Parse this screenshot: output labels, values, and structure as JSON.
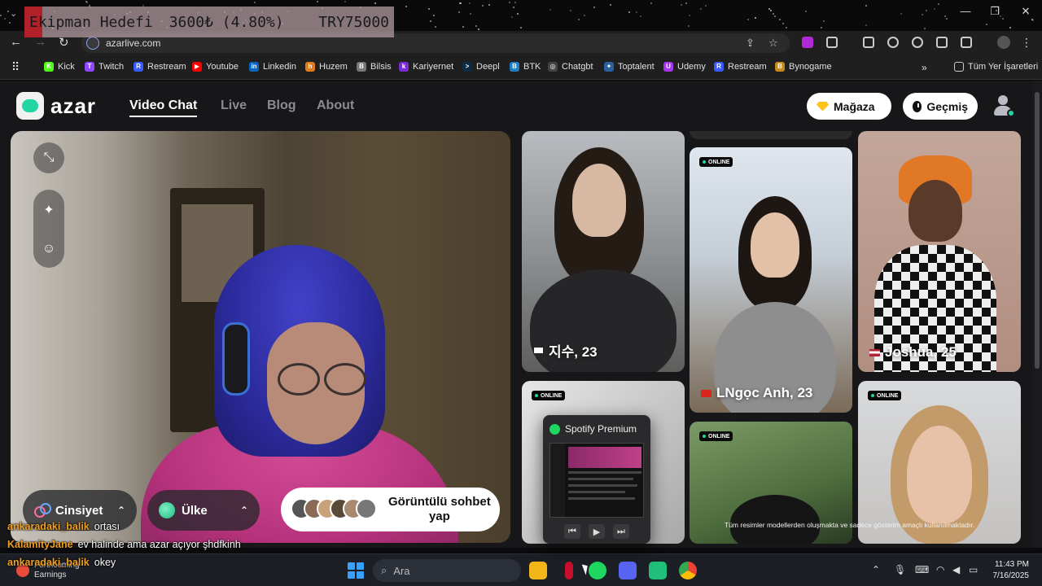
{
  "overlay": {
    "goal_label": "Ekipman Hedefi",
    "goal_amount": "3600₺ (4.80%)",
    "goal_target": "TRY75000",
    "goal_progress": 0.048
  },
  "browser": {
    "url": "azarlive.com",
    "window_controls": [
      "—",
      "❐",
      "✕"
    ],
    "bookmarks": [
      {
        "label": "Kick",
        "color": "#53fc18",
        "glyph": "K"
      },
      {
        "label": "Twitch",
        "color": "#9146ff",
        "glyph": "T"
      },
      {
        "label": "Restream",
        "color": "#3a5bff",
        "glyph": "R"
      },
      {
        "label": "Youtube",
        "color": "#ff0000",
        "glyph": "▶"
      },
      {
        "label": "Linkedin",
        "color": "#0a66c2",
        "glyph": "in"
      },
      {
        "label": "Huzem",
        "color": "#e07a1a",
        "glyph": "h"
      },
      {
        "label": "Bilsis",
        "color": "#777777",
        "glyph": "B"
      },
      {
        "label": "Kariyernet",
        "color": "#7b2bd6",
        "glyph": "k"
      },
      {
        "label": "Deepl",
        "color": "#0f2b46",
        "glyph": ">"
      },
      {
        "label": "BTK",
        "color": "#1e7fc5",
        "glyph": "B"
      },
      {
        "label": "Chatgbt",
        "color": "#444444",
        "glyph": "◎"
      },
      {
        "label": "Toptalent",
        "color": "#2c5fa0",
        "glyph": "✦"
      },
      {
        "label": "Udemy",
        "color": "#a435f0",
        "glyph": "U"
      },
      {
        "label": "Restream",
        "color": "#3a5bff",
        "glyph": "R"
      },
      {
        "label": "Bynogame",
        "color": "#c98a1a",
        "glyph": "B"
      }
    ],
    "all_bookmarks": "Tüm Yer İşaretleri"
  },
  "azar": {
    "logo": "azar",
    "nav": [
      "Video Chat",
      "Live",
      "Blog",
      "About"
    ],
    "shop_button": "Mağaza",
    "history_button": "Geçmiş",
    "filter_gender": "Cinsiyet",
    "filter_country": "Ülke",
    "start_button": "Görüntülü sohbet yap",
    "cards": [
      {
        "name": "지수, 23",
        "online": false
      },
      {
        "name": "LNgọc Anh, 23",
        "online": true
      },
      {
        "name": "Joshua, 25",
        "online": false
      },
      {
        "name": "",
        "online": true
      },
      {
        "name": "",
        "online": true
      },
      {
        "name": "",
        "online": true
      }
    ],
    "online_label": "ONLINE",
    "disclaimer": "Tüm resimler modellerden oluşmakta ve sadece gösterim amaçlı kullanılmaktadır."
  },
  "spotify_preview": {
    "title": "Spotify Premium"
  },
  "chat": [
    {
      "user": "ankaradaki_balik",
      "message": "ortası"
    },
    {
      "user": "KalamityJane",
      "message": "ev halinde ama azar açıyor şhdfkinh"
    },
    {
      "user": "ankaradaki_balik",
      "message": "okey"
    }
  ],
  "taskbar": {
    "weather_title": "Forthcoming",
    "weather_sub": "Earnings",
    "search_placeholder": "Ara",
    "time": "11:43 PM",
    "date": "7/16/2025"
  }
}
